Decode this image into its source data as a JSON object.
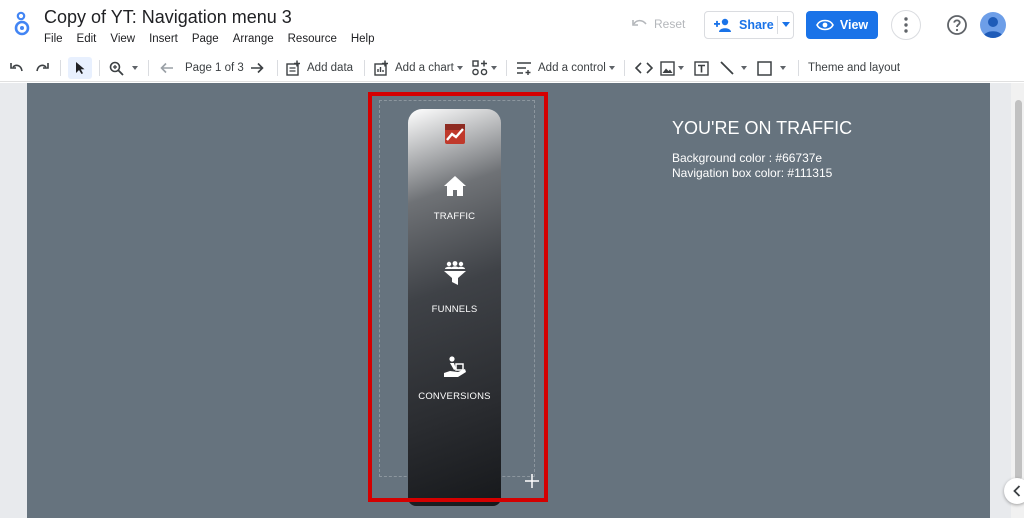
{
  "header": {
    "title": "Copy of YT: Navigation menu 3",
    "menu": [
      "File",
      "Edit",
      "View",
      "Insert",
      "Page",
      "Arrange",
      "Resource",
      "Help"
    ],
    "reset_label": "Reset",
    "share_label": "Share",
    "view_label": "View"
  },
  "toolbar": {
    "page_indicator": "Page 1 of 3",
    "add_data_label": "Add data",
    "add_chart_label": "Add a chart",
    "add_control_label": "Add a control",
    "theme_label": "Theme and layout"
  },
  "canvas": {
    "page_background": "#66737e",
    "nav_items": [
      {
        "label": "TRAFFIC",
        "icon": "home-icon"
      },
      {
        "label": "FUNNELS",
        "icon": "funnel-people-icon"
      },
      {
        "label": "CONVERSIONS",
        "icon": "conversion-hand-icon"
      }
    ],
    "info": {
      "title": "YOU'RE ON TRAFFIC",
      "line1": "Background color : #66737e",
      "line2": "Navigation box color: #111315"
    }
  },
  "colors": {
    "accent": "#1a73e8",
    "selection": "#d40000"
  }
}
